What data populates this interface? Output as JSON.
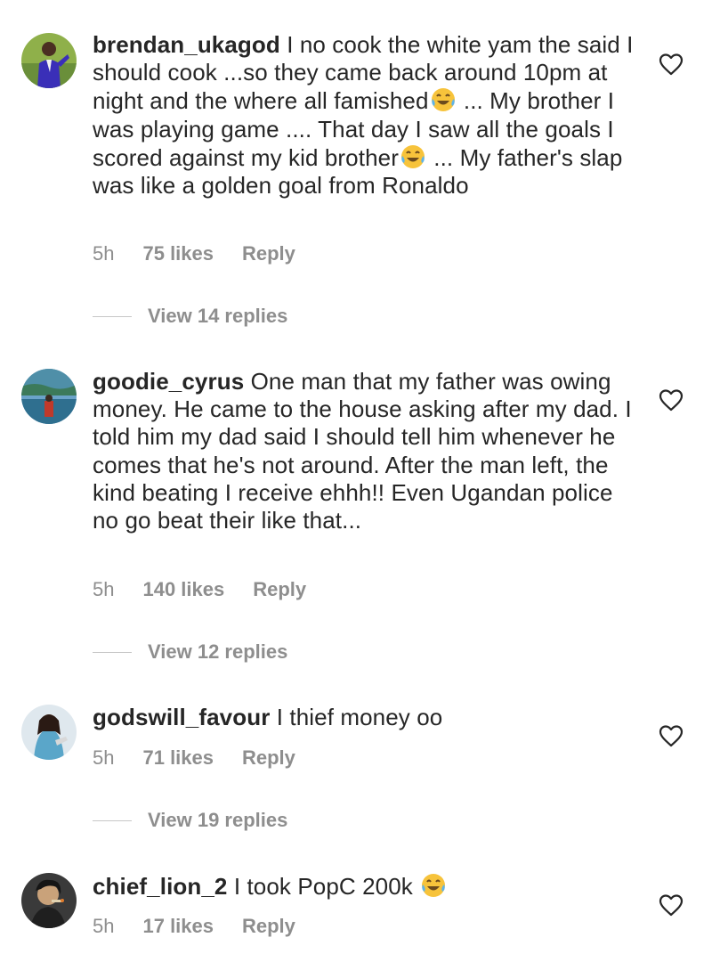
{
  "comments": [
    {
      "username": "brendan_ukagod",
      "parts": [
        "I no cook the white yam the said I should cook ...so they came back around 10pm at night and the where all famished",
        " ... My brother I was playing game .... That day I saw all the goals I scored against my kid brother",
        " ... My father's slap was like a golden goal from Ronaldo"
      ],
      "time": "5h",
      "likes": "75 likes",
      "reply": "Reply",
      "view_replies": "View 14 replies",
      "avatar": "avatar-purple-suit"
    },
    {
      "username": "goodie_cyrus",
      "text": "One man that my father was owing money. He came to the house asking after my dad. I told him my dad said I should tell him whenever he comes that he's not around. After the man left, the kind beating I receive ehhh!! Even Ugandan police no go beat their like that...",
      "time": "5h",
      "likes": "140 likes",
      "reply": "Reply",
      "view_replies": "View 12 replies",
      "avatar": "avatar-lake"
    },
    {
      "username": "godswill_favour",
      "text": "I thief money oo",
      "time": "5h",
      "likes": "71 likes",
      "reply": "Reply",
      "view_replies": "View 19 replies",
      "avatar": "avatar-girl"
    },
    {
      "username": "chief_lion_2",
      "text": "I took PopC 200k",
      "time": "5h",
      "likes": "17 likes",
      "reply": "Reply",
      "avatar": "avatar-man-cigar"
    }
  ],
  "icons": {
    "like": "heart-outline-icon",
    "emoji": "face-with-tears-of-joy-icon"
  },
  "colors": {
    "text": "#262626",
    "meta": "#8e8e8e",
    "divider": "#c7c7c7"
  }
}
